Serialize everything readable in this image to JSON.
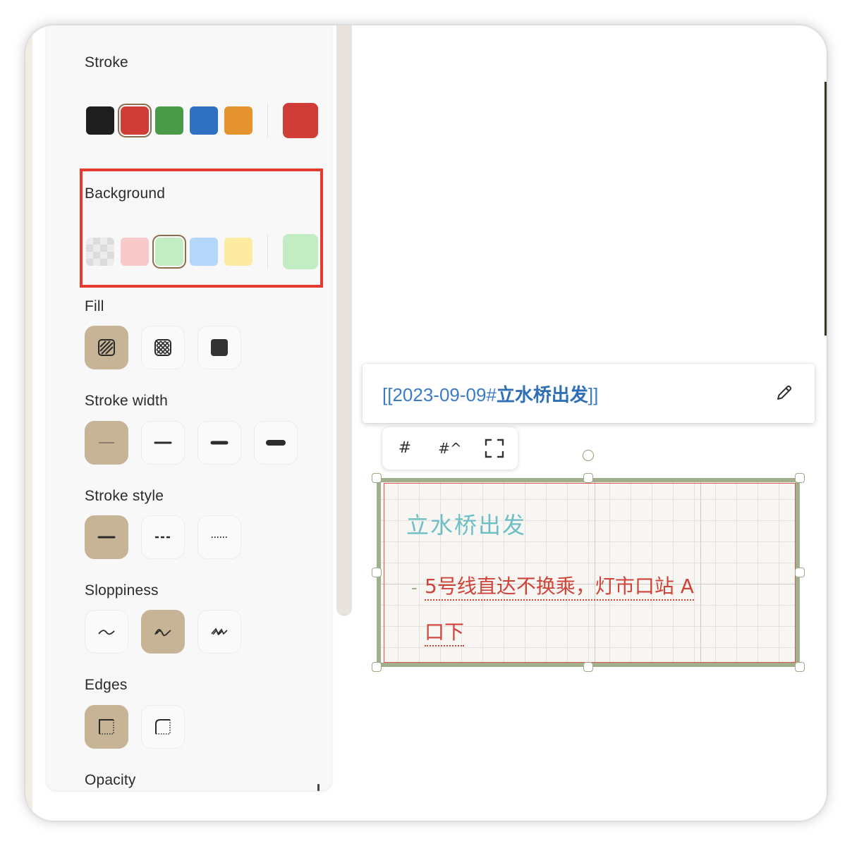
{
  "panel": {
    "stroke": {
      "label": "Stroke",
      "colors": [
        "#1e1e1e",
        "#d03d36",
        "#4a9a4a",
        "#3070c2",
        "#e5932e"
      ],
      "selected": "#d03d36"
    },
    "background": {
      "label": "Background",
      "colors": [
        "transparent",
        "#f8c9c9",
        "#c2ecc2",
        "#b4d6fb",
        "#fdeba2"
      ],
      "selected": "#c2ecc2"
    },
    "fill": {
      "label": "Fill",
      "options": [
        "hatch-icon",
        "cross-hatch-icon",
        "solid-icon"
      ],
      "selected": "hatch-icon"
    },
    "stroke_width": {
      "label": "Stroke width",
      "options": [
        "thin",
        "bold",
        "extra-bold",
        "heavy"
      ],
      "selected": "thin"
    },
    "stroke_style": {
      "label": "Stroke style",
      "options": [
        "solid",
        "dashed",
        "dotted"
      ],
      "selected": "solid"
    },
    "sloppiness": {
      "label": "Sloppiness",
      "options": [
        "architect",
        "artist",
        "cartoonist"
      ],
      "selected": "artist"
    },
    "edges": {
      "label": "Edges",
      "options": [
        "sharp",
        "round"
      ],
      "selected": "sharp"
    },
    "opacity": {
      "label": "Opacity"
    }
  },
  "link_bar": {
    "prefix": "[[2023-09-09#",
    "highlight": "立水桥出发",
    "suffix": "]]",
    "edit_icon": "pencil-icon"
  },
  "mini_toolbar": {
    "buttons": [
      "#",
      "#^"
    ],
    "fullscreen_icon": "fullscreen-icon"
  },
  "card": {
    "title": "立水桥出发",
    "bullet": "-",
    "line1": "5号线直达不换乘，灯市口站 A",
    "line2": "口下"
  }
}
